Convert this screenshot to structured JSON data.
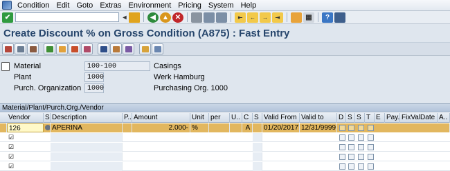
{
  "menu": {
    "items": [
      "Condition",
      "Edit",
      "Goto",
      "Extras",
      "Environment",
      "Pricing",
      "System",
      "Help"
    ]
  },
  "toolbar": {
    "command_field": "",
    "buttons": [
      "enter-icon",
      "save-icon",
      "back-icon",
      "exit-icon",
      "cancel-icon",
      "print-icon",
      "find-icon",
      "find-next-icon",
      "first-page-icon",
      "prev-page-icon",
      "next-page-icon",
      "last-page-icon",
      "new-session-icon",
      "shortcut-icon",
      "help-icon",
      "layout-icon"
    ]
  },
  "title": "Create Discount % on Gross Condition (A875) : Fast Entry",
  "app_toolbar": {
    "buttons": [
      "condition-info-icon",
      "overview-icon",
      "scales-icon",
      "arrow-icon",
      "details-icon",
      "copy-icon",
      "info-icon",
      "structure-icon",
      "other-icon",
      "display-icon",
      "more-icon"
    ]
  },
  "header": {
    "material_label": "Material",
    "material_value": "100-100",
    "material_desc": "Casings",
    "plant_label": "Plant",
    "plant_value": "1000",
    "plant_desc": "Werk Hamburg",
    "porg_label": "Purch. Organization",
    "porg_value": "1000",
    "porg_desc": "Purchasing Org. 1000"
  },
  "grid": {
    "caption": "Material/Plant/Purch.Org./Vendor",
    "columns": [
      "Vendor",
      "S",
      "Description",
      "P..",
      "Amount",
      "Unit",
      "per",
      "U..",
      "C",
      "S",
      "Valid From",
      "Valid to",
      "D",
      "S",
      "S",
      "T",
      "E",
      "Pay...",
      "FixValDate",
      "A.."
    ],
    "rows": [
      {
        "vendor": "126",
        "description": "APERINA",
        "amount": "2.000-",
        "unit": "%",
        "c": "A",
        "valid_from": "01/20/2017",
        "valid_to": "12/31/9999"
      }
    ],
    "empty_row_count": 4
  },
  "colors": {
    "title": "#27466c",
    "selected_row": "#e2b75f",
    "background": "#dfe6ee"
  }
}
